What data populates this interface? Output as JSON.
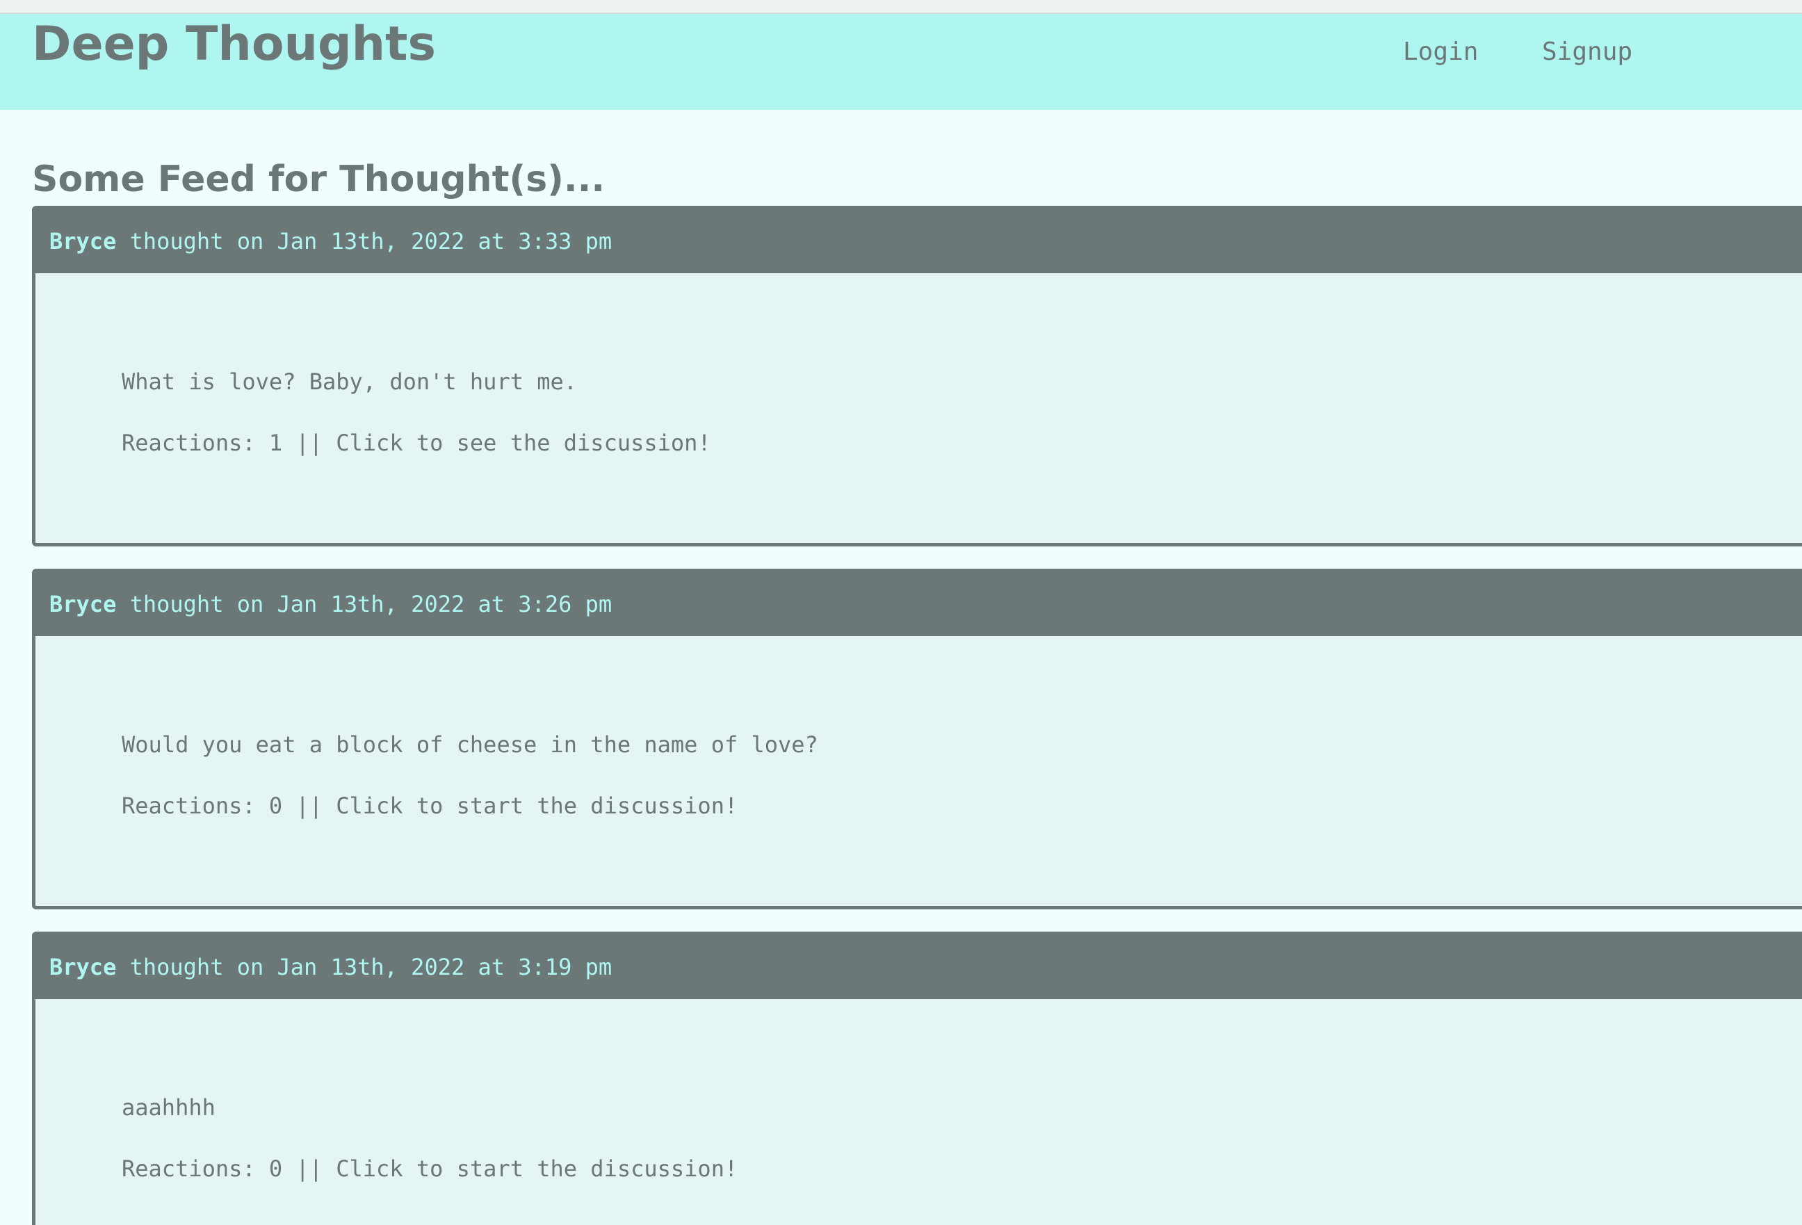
{
  "header": {
    "title": "Deep Thoughts",
    "nav": {
      "login": "Login",
      "signup": "Signup"
    }
  },
  "main": {
    "feed_title": "Some Feed for Thought(s)..."
  },
  "thoughts": [
    {
      "author": "Bryce",
      "meta": " thought on Jan 13th, 2022 at 3:33 pm",
      "text": "What is love? Baby, don't hurt me.",
      "reactions": "Reactions: 1 || Click to see the discussion!"
    },
    {
      "author": "Bryce",
      "meta": " thought on Jan 13th, 2022 at 3:26 pm",
      "text": "Would you eat a block of cheese in the name of love?",
      "reactions": "Reactions: 0 || Click to start the discussion!"
    },
    {
      "author": "Bryce",
      "meta": " thought on Jan 13th, 2022 at 3:19 pm",
      "text": "aaahhhh",
      "reactions": "Reactions: 0 || Click to start the discussion!"
    }
  ],
  "colors": {
    "header_bg": "#aff5f0",
    "page_bg": "#f2fdfd",
    "card_bg": "#e4f5f4",
    "card_header_bg": "#6c7777",
    "text": "#6c7777",
    "accent": "#aff5f0"
  }
}
